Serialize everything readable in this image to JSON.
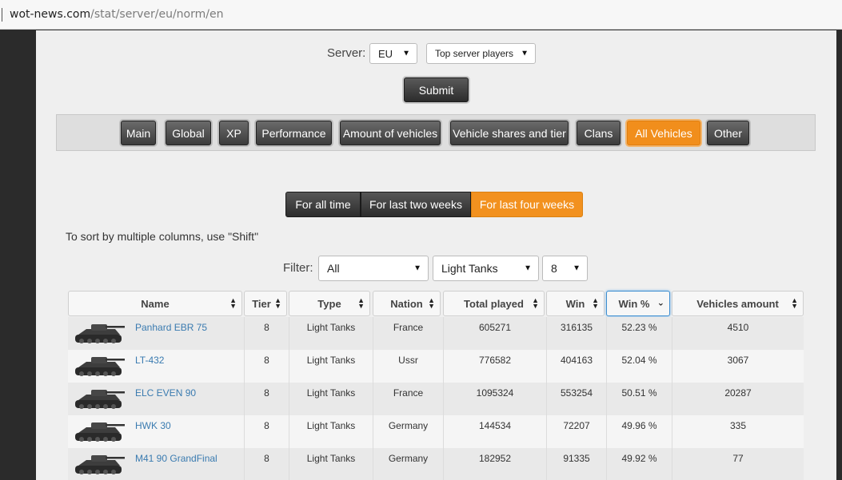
{
  "browser": {
    "url_host": "wot-news.com",
    "url_path": "/stat/server/eu/norm/en"
  },
  "form": {
    "server_label": "Server:",
    "server_value": "EU",
    "mode_value": "Top server players",
    "submit_label": "Submit"
  },
  "tabs": [
    {
      "label": "Main"
    },
    {
      "label": "Global"
    },
    {
      "label": "XP"
    },
    {
      "label": "Performance"
    },
    {
      "label": "Amount of vehicles"
    },
    {
      "label": "Vehicle shares and tier"
    },
    {
      "label": "Clans"
    },
    {
      "label": "All Vehicles",
      "active": true
    },
    {
      "label": "Other"
    }
  ],
  "periods": [
    {
      "label": "For all time"
    },
    {
      "label": "For last two weeks"
    },
    {
      "label": "For last four weeks",
      "active": true
    }
  ],
  "sort_hint": "To sort by multiple columns, use \"Shift\"",
  "filter": {
    "label": "Filter:",
    "nation": "All",
    "type": "Light Tanks",
    "tier": "8"
  },
  "table": {
    "columns": [
      "Name",
      "Tier",
      "Type",
      "Nation",
      "Total played",
      "Win",
      "Win %",
      "Vehicles amount"
    ],
    "sorted_column": "Win %",
    "rows": [
      {
        "name": "Panhard EBR 75",
        "tier": "8",
        "type": "Light Tanks",
        "nation": "France",
        "total": "605271",
        "win": "316135",
        "winpct": "52.23 %",
        "amount": "4510"
      },
      {
        "name": "LT-432",
        "tier": "8",
        "type": "Light Tanks",
        "nation": "Ussr",
        "total": "776582",
        "win": "404163",
        "winpct": "52.04 %",
        "amount": "3067"
      },
      {
        "name": "ELC EVEN 90",
        "tier": "8",
        "type": "Light Tanks",
        "nation": "France",
        "total": "1095324",
        "win": "553254",
        "winpct": "50.51 %",
        "amount": "20287"
      },
      {
        "name": "HWK 30",
        "tier": "8",
        "type": "Light Tanks",
        "nation": "Germany",
        "total": "144534",
        "win": "72207",
        "winpct": "49.96 %",
        "amount": "335"
      },
      {
        "name": "M41 90 GrandFinal",
        "tier": "8",
        "type": "Light Tanks",
        "nation": "Germany",
        "total": "182952",
        "win": "91335",
        "winpct": "49.92 %",
        "amount": "77"
      }
    ]
  },
  "colors": {
    "accent": "#f18e1c",
    "link": "#3a7bb0",
    "button_dark": "#3c3c3c",
    "sorted_border": "#3e8ed0"
  },
  "icons": {
    "dropdown": "triangle-down-icon",
    "sort": "sort-updown-icon",
    "sort_desc": "chevron-down-icon",
    "vehicle": "tank-thumbnail-icon"
  }
}
